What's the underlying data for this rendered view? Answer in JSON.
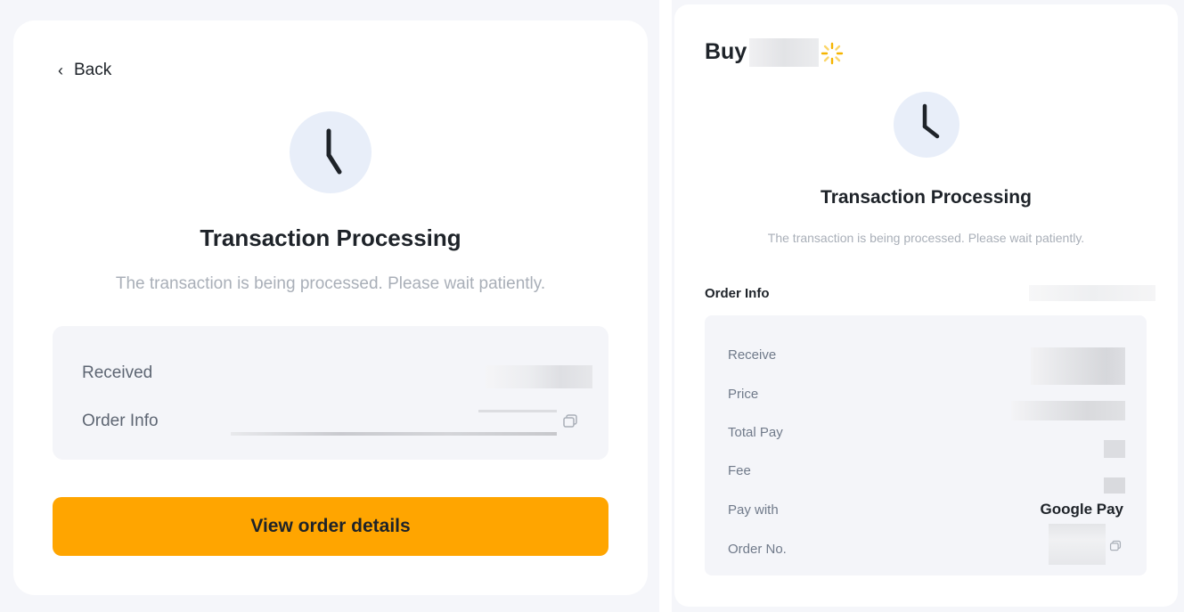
{
  "left_panel": {
    "back_label": "Back",
    "title": "Transaction Processing",
    "subtitle": "The transaction is being processed. Please wait patiently.",
    "info_rows": [
      {
        "label": "Received"
      },
      {
        "label": "Order Info"
      }
    ],
    "button_label": "View order details"
  },
  "right_panel": {
    "heading": "Buy",
    "title": "Transaction Processing",
    "subtitle": "The transaction is being processed. Please wait patiently.",
    "order_info_label": "Order Info",
    "details": [
      {
        "label": "Receive"
      },
      {
        "label": "Price"
      },
      {
        "label": "Total Pay"
      },
      {
        "label": "Fee"
      },
      {
        "label": "Pay with",
        "value": "Google Pay"
      },
      {
        "label": "Order No."
      }
    ]
  },
  "colors": {
    "accent": "#ffa500",
    "clock_bg": "#e8eef9",
    "text_primary": "#1e2329",
    "text_muted": "#a9afb8"
  },
  "icons": [
    "chevron-left-icon",
    "clock-icon",
    "copy-icon",
    "spinner-icon"
  ]
}
